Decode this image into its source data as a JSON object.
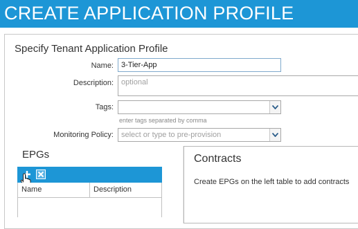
{
  "header": {
    "title": "CREATE APPLICATION PROFILE"
  },
  "form": {
    "section_title": "Specify Tenant Application Profile",
    "name": {
      "label": "Name:",
      "value": "3-Tier-App"
    },
    "description": {
      "label": "Description:",
      "placeholder": "optional"
    },
    "tags": {
      "label": "Tags:",
      "value": "",
      "hint": "enter tags separated by comma"
    },
    "monitoring_policy": {
      "label": "Monitoring Policy:",
      "placeholder": "select or type to pre-provision"
    }
  },
  "epgs": {
    "title": "EPGs",
    "toolbar": {
      "add_icon": "plus-icon",
      "delete_icon": "delete-x-icon"
    },
    "columns": [
      "Name",
      "Description"
    ]
  },
  "contracts": {
    "title": "Contracts",
    "message": "Create EPGs on the left table to add contracts"
  },
  "colors": {
    "accent": "#1d96d6",
    "header_text": "#ffffff"
  }
}
